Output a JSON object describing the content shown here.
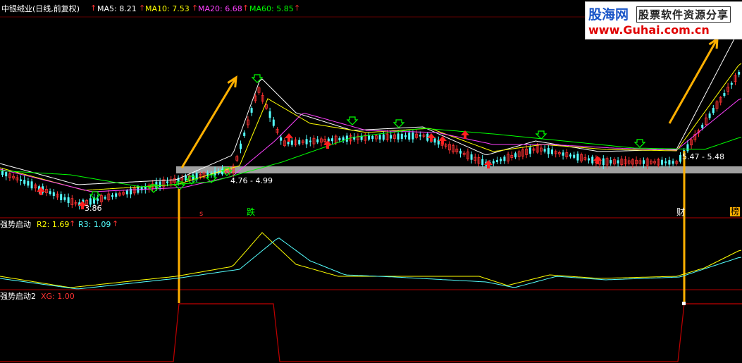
{
  "header": {
    "title": "中银绒业(日线,前复权)",
    "ma": [
      {
        "label": "MA5: 8.21",
        "color": "#ffffff"
      },
      {
        "label": "MA10: 7.53",
        "color": "#ffff00"
      },
      {
        "label": "MA20: 6.68",
        "color": "#ff40ff"
      },
      {
        "label": "MA60: 5.85",
        "color": "#00ff00"
      }
    ]
  },
  "watermark": {
    "brand": "股海网",
    "tagline": "股票软件资源分享",
    "url": "www.Guhai.com.cn"
  },
  "price_labels": {
    "low": "3.86",
    "range1": "4.76 - 4.99",
    "range2": "5.47 - 5.48"
  },
  "event_labels": {
    "mid": "跌",
    "right1": "财",
    "right2": "榜",
    "left": "s"
  },
  "panel2": {
    "name": "强势启动",
    "r2": "R2: 1.69",
    "r3": "R3: 1.09"
  },
  "panel3": {
    "name": "强势启动2",
    "xg": "XG: 1.00"
  },
  "colors": {
    "up": "#ff3232",
    "down": "#54ffff",
    "ma5": "#ffffff",
    "ma10": "#ffff00",
    "ma20": "#ff40ff",
    "ma60": "#00ff00",
    "signal": "#ffb000",
    "divider": "#b00000"
  },
  "chart_data": [
    {
      "type": "candlestick",
      "title": "中银绒业(日线,前复权)",
      "series": [
        {
          "name": "MA5",
          "last": 8.21
        },
        {
          "name": "MA10",
          "last": 7.53
        },
        {
          "name": "MA20",
          "last": 6.68
        },
        {
          "name": "MA60",
          "last": 5.85
        }
      ],
      "annotations": [
        "3.86",
        "4.76 - 4.99",
        "5.47 - 5.48"
      ],
      "price_points": {
        "x": [
          0,
          110,
          250,
          330,
          365,
          400,
          500,
          600,
          690,
          760,
          850,
          960,
          1050
        ],
        "y": [
          5.1,
          3.86,
          4.8,
          5.2,
          8.3,
          6.2,
          6.4,
          6.5,
          5.4,
          6.0,
          5.5,
          5.47,
          9.0
        ]
      }
    },
    {
      "type": "line",
      "title": "强势启动",
      "series": [
        {
          "name": "R2",
          "last": 1.69
        },
        {
          "name": "R3",
          "last": 1.09
        }
      ]
    },
    {
      "type": "line",
      "title": "强势启动2",
      "series": [
        {
          "name": "XG",
          "last": 1.0
        }
      ]
    }
  ]
}
